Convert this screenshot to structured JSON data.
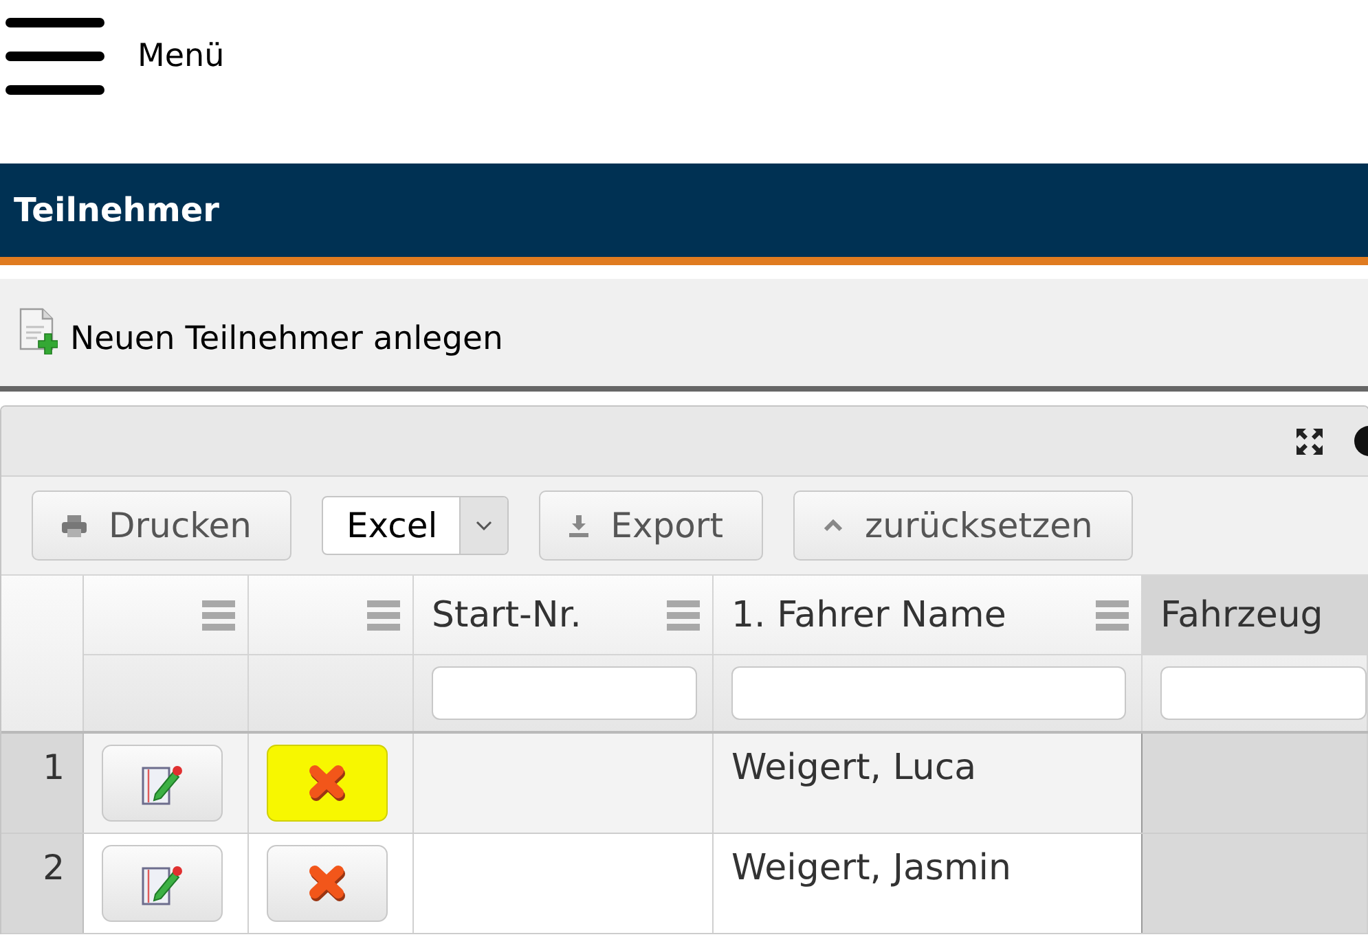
{
  "menu": {
    "label": "Menü"
  },
  "header": {
    "title": "Teilnehmer"
  },
  "actions": [
    {
      "label": "Neuen Teilnehmer anlegen"
    }
  ],
  "grid": {
    "toolbar": [
      {
        "kind": "print",
        "label": "Drucken"
      },
      {
        "kind": "select",
        "value": "Excel"
      },
      {
        "kind": "export",
        "label": "Export"
      },
      {
        "kind": "reset",
        "label": "zurücksetzen"
      }
    ],
    "columns": [
      {
        "kind": "edit",
        "menu": true,
        "filter": false,
        "highlighted": false
      },
      {
        "kind": "delete",
        "menu": true,
        "filter": false,
        "highlighted": false
      },
      {
        "kind": "start_nr",
        "label": "Start-Nr.",
        "menu": true,
        "filter": true,
        "highlighted": false
      },
      {
        "kind": "driver",
        "label": "1. Fahrer Name",
        "menu": true,
        "filter": true,
        "highlighted": false
      },
      {
        "kind": "vehicle",
        "label": "Fahrzeug",
        "menu": false,
        "filter": true,
        "highlighted": true
      }
    ],
    "rows": [
      {
        "number": "1",
        "driver_name": "Weigert, Luca",
        "delete_highlighted": true
      },
      {
        "number": "2",
        "driver_name": "Weigert, Jasmin",
        "delete_highlighted": false
      }
    ]
  }
}
